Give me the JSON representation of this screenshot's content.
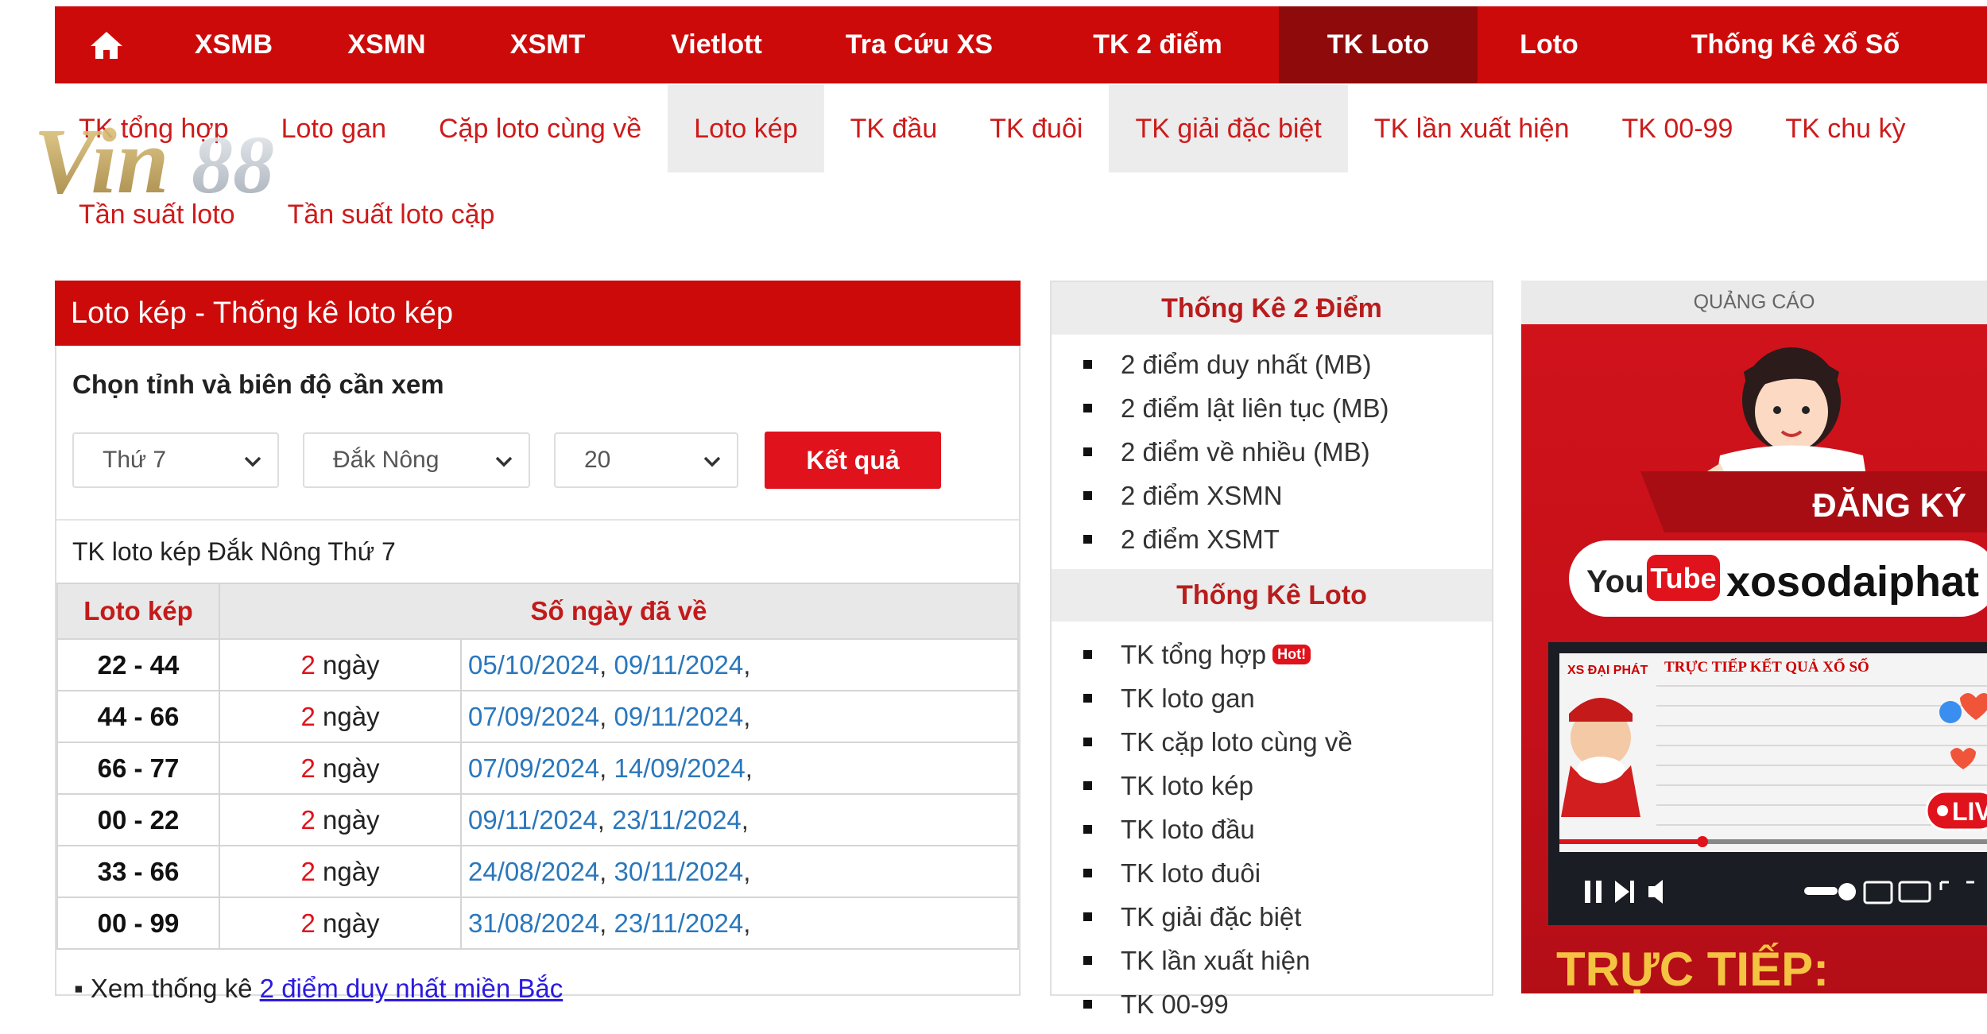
{
  "topnav": {
    "items": [
      "XSMB",
      "XSMN",
      "XSMT",
      "Vietlott",
      "Tra Cứu XS",
      "TK 2 điểm",
      "TK Loto",
      "Loto",
      "Thống Kê Xổ Số"
    ],
    "active": "TK Loto"
  },
  "subnav": {
    "row1": [
      "TK tổng hợp",
      "Loto gan",
      "Cặp loto cùng về",
      "Loto kép",
      "TK đầu",
      "TK đuôi",
      "TK giải đặc biệt",
      "TK lần xuất hiện",
      "TK 00-99",
      "TK chu kỳ"
    ],
    "row2": [
      "Tần suất loto",
      "Tần suất loto cặp"
    ]
  },
  "logo": {
    "text": "Vin88"
  },
  "panel": {
    "title": "Loto kép - Thống kê loto kép",
    "choose_label": "Chọn tỉnh và biên độ cần xem",
    "day": "Thứ 7",
    "province": "Đắk Nông",
    "range": "20",
    "button": "Kết quả",
    "caption": "TK loto kép Đắk Nông Thứ 7"
  },
  "table": {
    "headers": [
      "Loto kép",
      "Số ngày đã về"
    ],
    "unit": "ngày",
    "rows": [
      {
        "pair": "22 - 44",
        "count": "2",
        "dates": [
          "05/10/2024",
          "09/11/2024"
        ]
      },
      {
        "pair": "44 - 66",
        "count": "2",
        "dates": [
          "07/09/2024",
          "09/11/2024"
        ]
      },
      {
        "pair": "66 - 77",
        "count": "2",
        "dates": [
          "07/09/2024",
          "14/09/2024"
        ]
      },
      {
        "pair": "00 - 22",
        "count": "2",
        "dates": [
          "09/11/2024",
          "23/11/2024"
        ]
      },
      {
        "pair": "33 - 66",
        "count": "2",
        "dates": [
          "24/08/2024",
          "30/11/2024"
        ]
      },
      {
        "pair": "00 - 99",
        "count": "2",
        "dates": [
          "31/08/2024",
          "23/11/2024"
        ]
      }
    ]
  },
  "footnote": {
    "prefix": "Xem thống kê",
    "link": "2 điểm duy nhất miền Bắc"
  },
  "sidebar": {
    "section1": {
      "title": "Thống Kê 2 Điểm",
      "items": [
        "2 điểm duy nhất (MB)",
        "2 điểm lật liên tục (MB)",
        "2 điểm về nhiều (MB)",
        "2 điểm XSMN",
        "2 điểm XSMT"
      ]
    },
    "section2": {
      "title": "Thống Kê Loto",
      "items": [
        "TK tổng hợp",
        "TK loto gan",
        "TK cặp loto cùng về",
        "TK loto kép",
        "TK loto đầu",
        "TK loto đuôi",
        "TK giải đặc biệt",
        "TK lần xuất hiện",
        "TK 00-99"
      ],
      "hot_badge": "Hot!"
    }
  },
  "ad": {
    "label": "QUẢNG CÁO",
    "subscribe": "ĐĂNG KÝ",
    "youtube_you": "You",
    "youtube_tube": "Tube",
    "channel": "xosodaiphat",
    "live": "LIVE",
    "live_title": "TRỰC TIẾP:",
    "video_brand": "XS ĐẠI PHÁT",
    "video_heading": "TRỰC TIẾP KẾT QUẢ XỔ SỐ"
  },
  "colors": {
    "brand_red": "#cd0a0a",
    "active_nav": "#8f0a0a",
    "link_blue": "#2a77bc",
    "button_red": "#e0121b"
  }
}
